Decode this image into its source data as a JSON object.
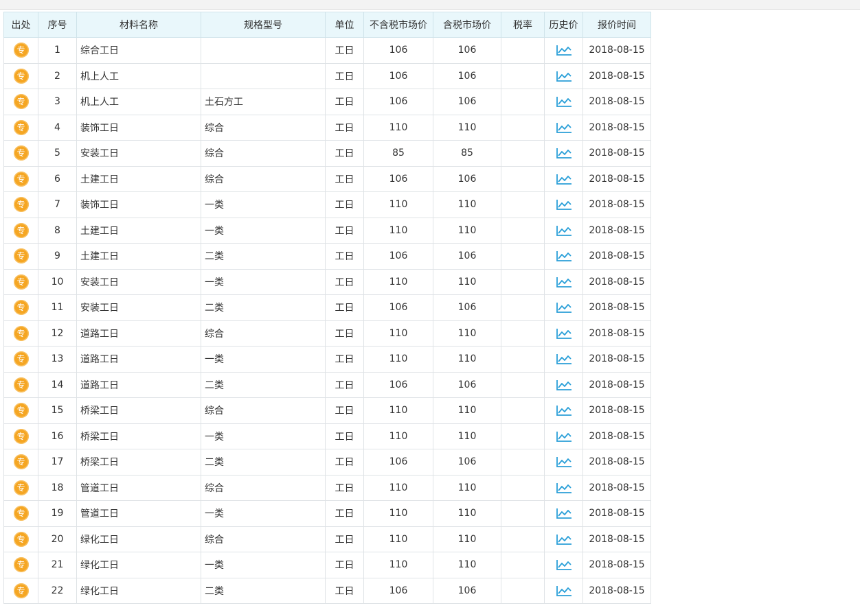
{
  "table": {
    "columns": [
      {
        "key": "source",
        "label": "出处"
      },
      {
        "key": "index",
        "label": "序号"
      },
      {
        "key": "name",
        "label": "材料名称"
      },
      {
        "key": "spec",
        "label": "规格型号"
      },
      {
        "key": "unit",
        "label": "单位"
      },
      {
        "key": "price_ex_tax",
        "label": "不含税市场价"
      },
      {
        "key": "price_inc_tax",
        "label": "含税市场价"
      },
      {
        "key": "tax_rate",
        "label": "税率"
      },
      {
        "key": "history",
        "label": "历史价"
      },
      {
        "key": "date",
        "label": "报价时间"
      }
    ],
    "badge_color": "#f5a623",
    "icon_color": "#2a9fd8",
    "rows": [
      {
        "source": "专",
        "index": "1",
        "name": "综合工日",
        "spec": "",
        "unit": "工日",
        "price_ex_tax": "106",
        "price_inc_tax": "106",
        "tax_rate": "",
        "history_icon": "line-chart-icon",
        "date": "2018-08-15"
      },
      {
        "source": "专",
        "index": "2",
        "name": "机上人工",
        "spec": "",
        "unit": "工日",
        "price_ex_tax": "106",
        "price_inc_tax": "106",
        "tax_rate": "",
        "history_icon": "line-chart-icon",
        "date": "2018-08-15"
      },
      {
        "source": "专",
        "index": "3",
        "name": "机上人工",
        "spec": "土石方工",
        "unit": "工日",
        "price_ex_tax": "106",
        "price_inc_tax": "106",
        "tax_rate": "",
        "history_icon": "line-chart-icon",
        "date": "2018-08-15"
      },
      {
        "source": "专",
        "index": "4",
        "name": "装饰工日",
        "spec": "综合",
        "unit": "工日",
        "price_ex_tax": "110",
        "price_inc_tax": "110",
        "tax_rate": "",
        "history_icon": "line-chart-icon",
        "date": "2018-08-15"
      },
      {
        "source": "专",
        "index": "5",
        "name": "安装工日",
        "spec": "综合",
        "unit": "工日",
        "price_ex_tax": "85",
        "price_inc_tax": "85",
        "tax_rate": "",
        "history_icon": "line-chart-icon",
        "date": "2018-08-15"
      },
      {
        "source": "专",
        "index": "6",
        "name": "土建工日",
        "spec": "综合",
        "unit": "工日",
        "price_ex_tax": "106",
        "price_inc_tax": "106",
        "tax_rate": "",
        "history_icon": "line-chart-icon",
        "date": "2018-08-15"
      },
      {
        "source": "专",
        "index": "7",
        "name": "装饰工日",
        "spec": "一类",
        "unit": "工日",
        "price_ex_tax": "110",
        "price_inc_tax": "110",
        "tax_rate": "",
        "history_icon": "line-chart-icon",
        "date": "2018-08-15"
      },
      {
        "source": "专",
        "index": "8",
        "name": "土建工日",
        "spec": "一类",
        "unit": "工日",
        "price_ex_tax": "110",
        "price_inc_tax": "110",
        "tax_rate": "",
        "history_icon": "line-chart-icon",
        "date": "2018-08-15"
      },
      {
        "source": "专",
        "index": "9",
        "name": "土建工日",
        "spec": "二类",
        "unit": "工日",
        "price_ex_tax": "106",
        "price_inc_tax": "106",
        "tax_rate": "",
        "history_icon": "line-chart-icon",
        "date": "2018-08-15"
      },
      {
        "source": "专",
        "index": "10",
        "name": "安装工日",
        "spec": "一类",
        "unit": "工日",
        "price_ex_tax": "110",
        "price_inc_tax": "110",
        "tax_rate": "",
        "history_icon": "line-chart-icon",
        "date": "2018-08-15"
      },
      {
        "source": "专",
        "index": "11",
        "name": "安装工日",
        "spec": "二类",
        "unit": "工日",
        "price_ex_tax": "106",
        "price_inc_tax": "106",
        "tax_rate": "",
        "history_icon": "line-chart-icon",
        "date": "2018-08-15"
      },
      {
        "source": "专",
        "index": "12",
        "name": "道路工日",
        "spec": "综合",
        "unit": "工日",
        "price_ex_tax": "110",
        "price_inc_tax": "110",
        "tax_rate": "",
        "history_icon": "line-chart-icon",
        "date": "2018-08-15"
      },
      {
        "source": "专",
        "index": "13",
        "name": "道路工日",
        "spec": "一类",
        "unit": "工日",
        "price_ex_tax": "110",
        "price_inc_tax": "110",
        "tax_rate": "",
        "history_icon": "line-chart-icon",
        "date": "2018-08-15"
      },
      {
        "source": "专",
        "index": "14",
        "name": "道路工日",
        "spec": "二类",
        "unit": "工日",
        "price_ex_tax": "106",
        "price_inc_tax": "106",
        "tax_rate": "",
        "history_icon": "line-chart-icon",
        "date": "2018-08-15"
      },
      {
        "source": "专",
        "index": "15",
        "name": "桥梁工日",
        "spec": "综合",
        "unit": "工日",
        "price_ex_tax": "110",
        "price_inc_tax": "110",
        "tax_rate": "",
        "history_icon": "line-chart-icon",
        "date": "2018-08-15"
      },
      {
        "source": "专",
        "index": "16",
        "name": "桥梁工日",
        "spec": "一类",
        "unit": "工日",
        "price_ex_tax": "110",
        "price_inc_tax": "110",
        "tax_rate": "",
        "history_icon": "line-chart-icon",
        "date": "2018-08-15"
      },
      {
        "source": "专",
        "index": "17",
        "name": "桥梁工日",
        "spec": "二类",
        "unit": "工日",
        "price_ex_tax": "106",
        "price_inc_tax": "106",
        "tax_rate": "",
        "history_icon": "line-chart-icon",
        "date": "2018-08-15"
      },
      {
        "source": "专",
        "index": "18",
        "name": "管道工日",
        "spec": "综合",
        "unit": "工日",
        "price_ex_tax": "110",
        "price_inc_tax": "110",
        "tax_rate": "",
        "history_icon": "line-chart-icon",
        "date": "2018-08-15"
      },
      {
        "source": "专",
        "index": "19",
        "name": "管道工日",
        "spec": "一类",
        "unit": "工日",
        "price_ex_tax": "110",
        "price_inc_tax": "110",
        "tax_rate": "",
        "history_icon": "line-chart-icon",
        "date": "2018-08-15"
      },
      {
        "source": "专",
        "index": "20",
        "name": "绿化工日",
        "spec": "综合",
        "unit": "工日",
        "price_ex_tax": "110",
        "price_inc_tax": "110",
        "tax_rate": "",
        "history_icon": "line-chart-icon",
        "date": "2018-08-15"
      },
      {
        "source": "专",
        "index": "21",
        "name": "绿化工日",
        "spec": "一类",
        "unit": "工日",
        "price_ex_tax": "110",
        "price_inc_tax": "110",
        "tax_rate": "",
        "history_icon": "line-chart-icon",
        "date": "2018-08-15"
      },
      {
        "source": "专",
        "index": "22",
        "name": "绿化工日",
        "spec": "二类",
        "unit": "工日",
        "price_ex_tax": "106",
        "price_inc_tax": "106",
        "tax_rate": "",
        "history_icon": "line-chart-icon",
        "date": "2018-08-15"
      }
    ]
  }
}
